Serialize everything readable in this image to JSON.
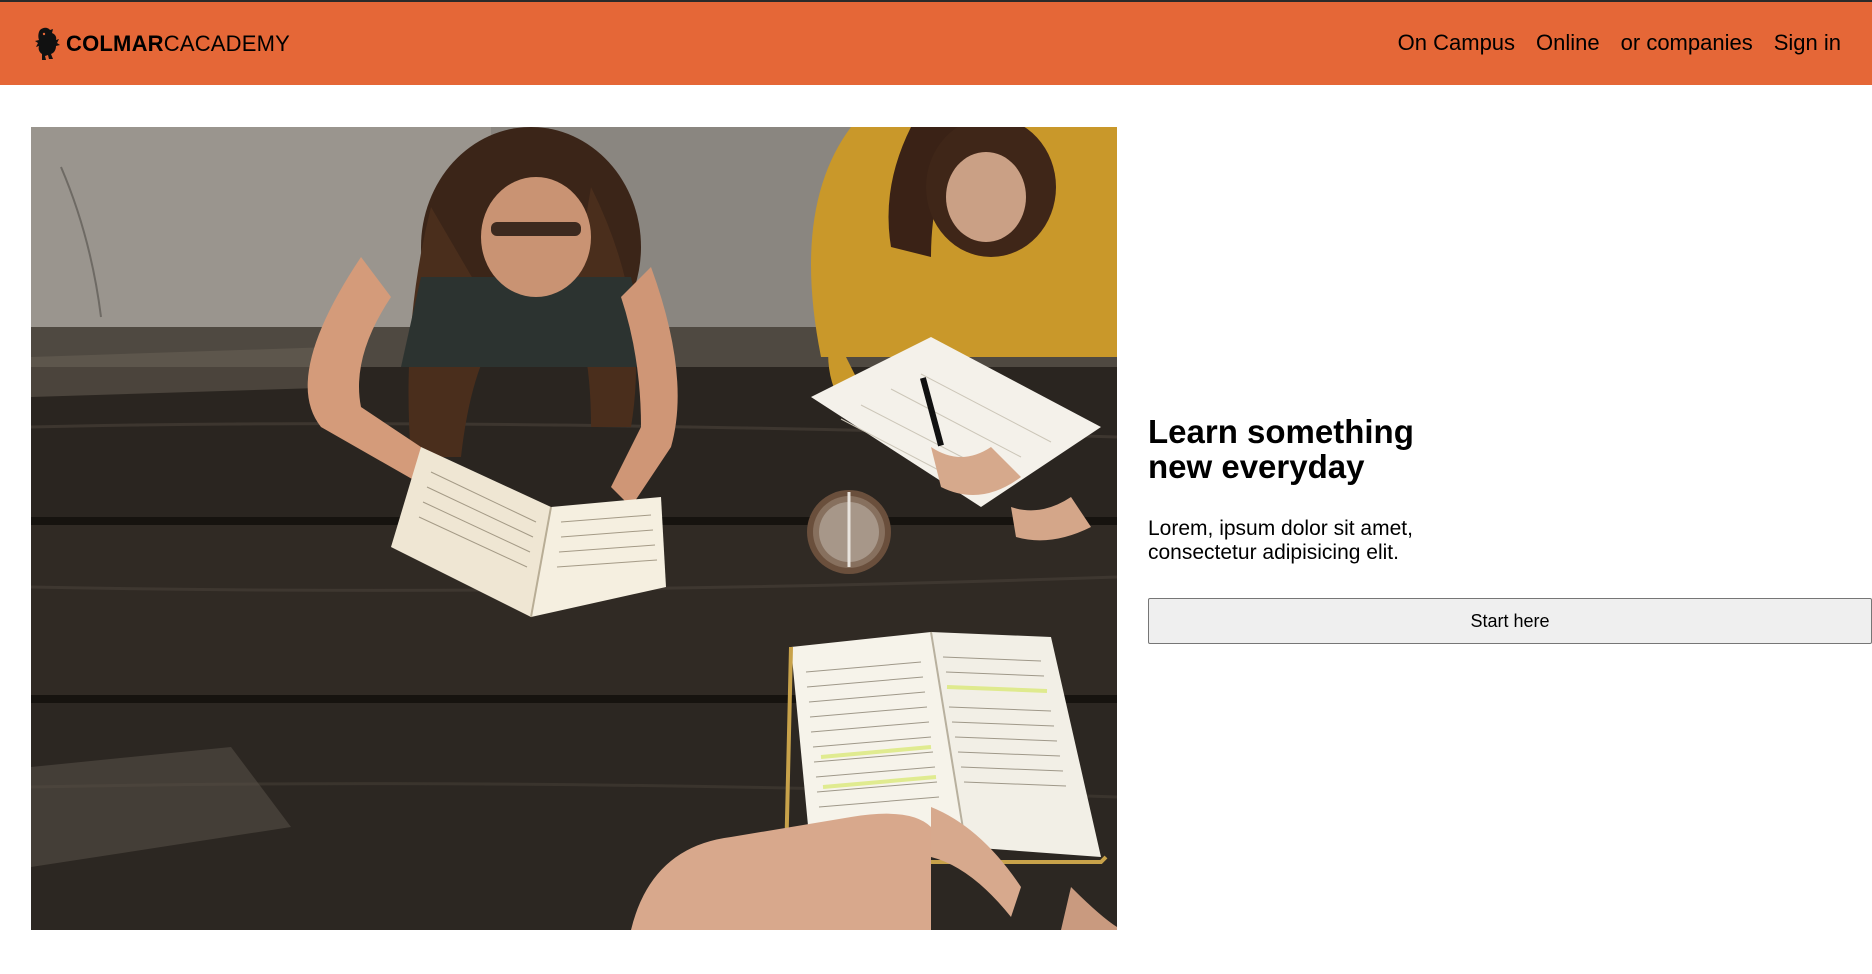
{
  "header": {
    "brand_bold": "COLMAR",
    "brand_regular": "CACADEMY",
    "logo_icon": "lion-rampant-icon",
    "nav": [
      {
        "label": "On Campus"
      },
      {
        "label": "Online"
      },
      {
        "label": "or companies"
      },
      {
        "label": "Sign in"
      }
    ]
  },
  "hero": {
    "image_icon": "students-studying-photo",
    "title": "Learn something new everyday",
    "subtitle": "Lorem, ipsum dolor sit amet, consectetur adipisicing elit.",
    "cta_label": "Start here"
  },
  "colors": {
    "navbar": "#e56737",
    "button_bg": "#efefef"
  }
}
